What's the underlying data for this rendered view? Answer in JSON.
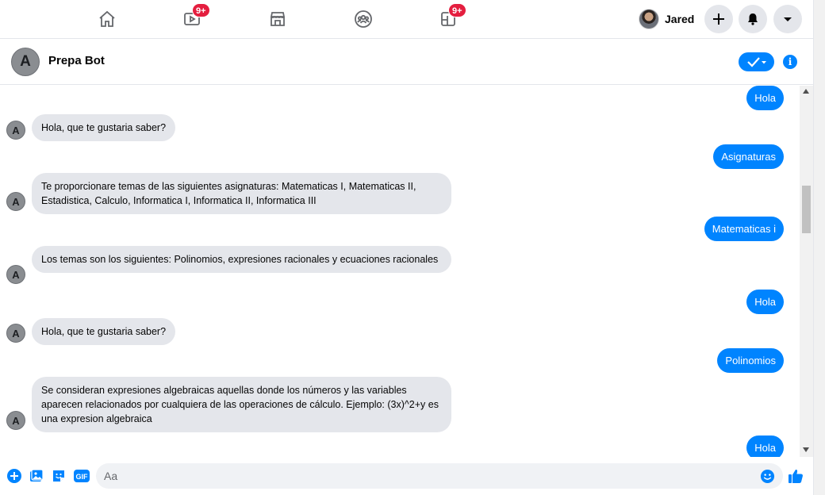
{
  "nav": {
    "watch_badge": "9+",
    "gaming_badge": "9+",
    "profile_name": "Jared"
  },
  "chat": {
    "bot_name": "Prepa Bot",
    "bot_initial": "A"
  },
  "messages": [
    {
      "from": "me",
      "text": "Hola"
    },
    {
      "from": "bot",
      "text": "Hola, que te gustaria saber?"
    },
    {
      "from": "me",
      "text": "Asignaturas"
    },
    {
      "from": "bot",
      "text": "Te proporcionare temas de las siguientes asignaturas: Matematicas I, Matematicas II, Estadistica, Calculo, Informatica I, Informatica II, Informatica III"
    },
    {
      "from": "me",
      "text": "Matematicas i"
    },
    {
      "from": "bot",
      "text": "Los temas son los siguientes: Polinomios, expresiones racionales y ecuaciones racionales"
    },
    {
      "from": "me",
      "text": "Hola"
    },
    {
      "from": "bot",
      "text": "Hola, que te gustaria saber?"
    },
    {
      "from": "me",
      "text": "Polinomios"
    },
    {
      "from": "bot",
      "text": "Se consideran expresiones algebraicas aquellas donde los números y las variables aparecen relacionados por cualquiera de las operaciones de cálculo. Ejemplo: (3x)^2+y es una expresion algebraica"
    },
    {
      "from": "me",
      "text": "Hola"
    }
  ],
  "composer": {
    "placeholder": "Aa",
    "gif_label": "GIF"
  },
  "colors": {
    "accent": "#0084ff",
    "bubble_in": "#e4e6eb",
    "badge": "#e41e3f"
  }
}
